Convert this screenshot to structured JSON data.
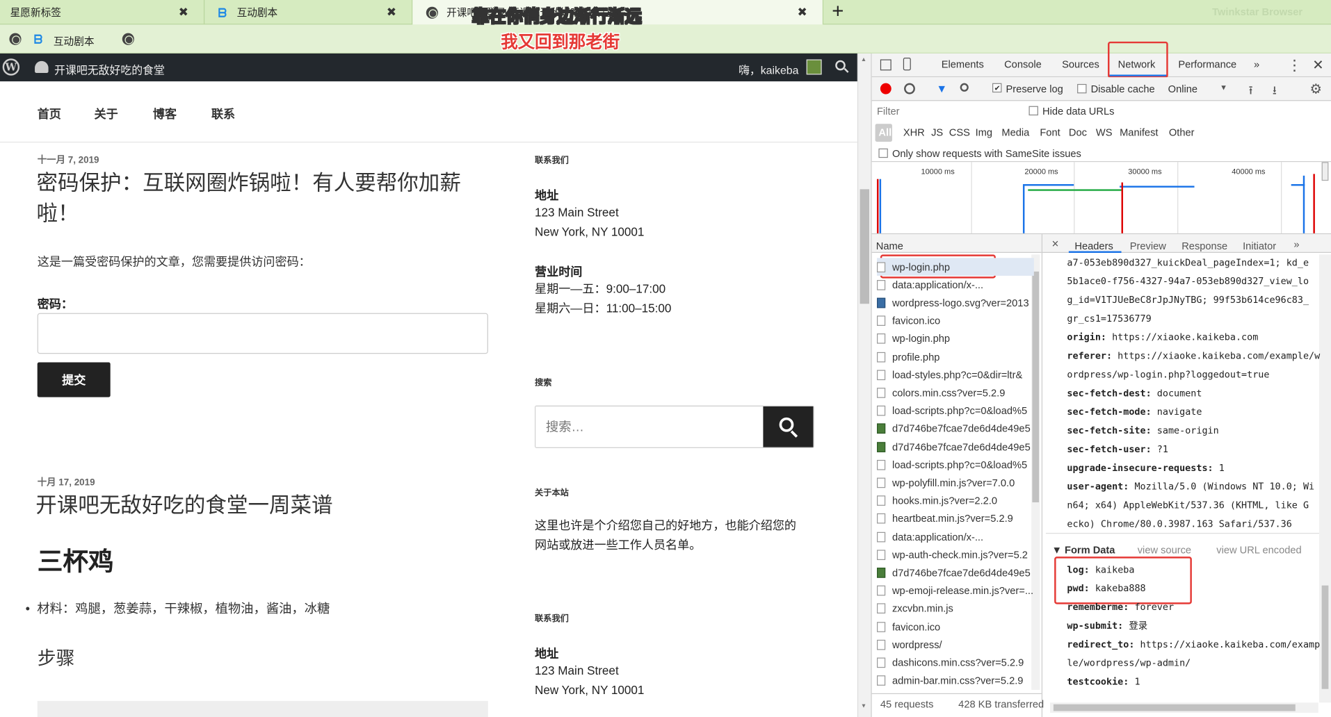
{
  "browser": {
    "tabs": [
      {
        "label": "星愿新标签",
        "close": "✖"
      },
      {
        "label": "互动剧本",
        "close": "✖"
      },
      {
        "label": "开课吧...登录‹开课吧无敌好吃的食堂",
        "close": "✖"
      }
    ],
    "new_tab": "+",
    "brand": "Twinkstar Browser",
    "bookmark": "互动剧本",
    "overlay_line1": "靠在你俏身边渐行渐远",
    "overlay_line2": "我又回到那老街"
  },
  "adminbar": {
    "site_name": "开课吧无敌好吃的食堂",
    "greeting": "嗨，kaikeba"
  },
  "page": {
    "nav": [
      "首页",
      "关于",
      "博客",
      "联系"
    ],
    "post1": {
      "date": "十一月 7, 2019",
      "title_line1": "密码保护：互联网圈炸锅啦！有人要帮你加薪",
      "title_line2": "啦！",
      "desc": "这是一篇受密码保护的文章，您需要提供访问密码：",
      "password_label": "密码：",
      "submit": "提交"
    },
    "post2": {
      "date": "十月 17, 2019",
      "title": "开课吧无敌好吃的食堂一周菜谱",
      "heading": "三杯鸡",
      "ingredients": "材料：鸡腿，葱姜蒜，干辣椒，植物油，酱油，冰糖",
      "steps": "步骤"
    },
    "sidebar": {
      "contact_heading": "联系我们",
      "address_label": "地址",
      "address_line1": "123 Main Street",
      "address_line2": "New York, NY 10001",
      "hours_label": "营业时间",
      "hours_line1": "星期一—五：9:00–17:00",
      "hours_line2": "星期六—日：11:00–15:00",
      "search_heading": "搜索",
      "search_placeholder": "搜索…",
      "about_heading": "关于本站",
      "about_line1": "这里也许是个介绍您自己的好地方，也能介绍您的",
      "about_line2": "网站或放进一些工作人员名单。",
      "contact_heading2": "联系我们",
      "address_label2": "地址",
      "address2_line1": "123 Main Street",
      "address2_line2": "New York, NY 10001"
    }
  },
  "devtools": {
    "tabs": [
      "Elements",
      "Console",
      "Sources",
      "Network",
      "Performance",
      "»"
    ],
    "preserve_log": "Preserve log",
    "disable_cache": "Disable cache",
    "throttle": "Online",
    "filter_placeholder": "Filter",
    "hide_data_urls": "Hide data URLs",
    "type_filters": [
      "All",
      "XHR",
      "JS",
      "CSS",
      "Img",
      "Media",
      "Font",
      "Doc",
      "WS",
      "Manifest",
      "Other"
    ],
    "samesite": "Only show requests with SameSite issues",
    "timeline_ticks": [
      "10000 ms",
      "20000 ms",
      "30000 ms",
      "40000 ms"
    ],
    "name_header": "Name",
    "requests": [
      "wp-login.php",
      "data:application/x-...",
      "wordpress-logo.svg?ver=2013",
      "favicon.ico",
      "wp-login.php",
      "profile.php",
      "load-styles.php?c=0&dir=ltr&",
      "colors.min.css?ver=5.2.9",
      "load-scripts.php?c=0&load%5",
      "d7d746be7fcae7de6d4de49e5",
      "d7d746be7fcae7de6d4de49e5",
      "load-scripts.php?c=0&load%5",
      "wp-polyfill.min.js?ver=7.0.0",
      "hooks.min.js?ver=2.2.0",
      "heartbeat.min.js?ver=5.2.9",
      "data:application/x-...",
      "wp-auth-check.min.js?ver=5.2",
      "d7d746be7fcae7de6d4de49e5",
      "wp-emoji-release.min.js?ver=...",
      "zxcvbn.min.js",
      "favicon.ico",
      "wordpress/",
      "dashicons.min.css?ver=5.2.9",
      "admin-bar.min.css?ver=5.2.9"
    ],
    "request_icons": [
      "doc",
      "doc",
      "svg",
      "doc",
      "doc",
      "doc",
      "doc",
      "doc",
      "doc",
      "img",
      "img",
      "doc",
      "doc",
      "doc",
      "doc",
      "doc",
      "doc",
      "img",
      "doc",
      "doc",
      "doc",
      "doc",
      "doc",
      "doc"
    ],
    "status_requests": "45 requests",
    "status_transferred": "428 KB transferred",
    "detail_tabs": [
      "Headers",
      "Preview",
      "Response",
      "Initiator",
      "»"
    ],
    "close": "×",
    "headers": [
      {
        "k": "",
        "v": "a7-053eb890d327_kuickDeal_pageIndex=1; kd_e"
      },
      {
        "k": "",
        "v": "5b1ace0-f756-4327-94a7-053eb890d327_view_lo"
      },
      {
        "k": "",
        "v": "g_id=V1TJUeBeC8rJpJNyTBG; 99f53b614ce96c83_"
      },
      {
        "k": "",
        "v": "gr_cs1=17536779"
      },
      {
        "k": "origin:",
        "v": " https://xiaoke.kaikeba.com"
      },
      {
        "k": "referer:",
        "v": " https://xiaoke.kaikeba.com/example/w"
      },
      {
        "k": "",
        "v": "ordpress/wp-login.php?loggedout=true"
      },
      {
        "k": "sec-fetch-dest:",
        "v": " document"
      },
      {
        "k": "sec-fetch-mode:",
        "v": " navigate"
      },
      {
        "k": "sec-fetch-site:",
        "v": " same-origin"
      },
      {
        "k": "sec-fetch-user:",
        "v": " ?1"
      },
      {
        "k": "upgrade-insecure-requests:",
        "v": " 1"
      },
      {
        "k": "user-agent:",
        "v": " Mozilla/5.0 (Windows NT 10.0; Wi"
      },
      {
        "k": "",
        "v": "n64; x64) AppleWebKit/537.36 (KHTML, like G"
      },
      {
        "k": "",
        "v": "ecko) Chrome/80.0.3987.163 Safari/537.36"
      }
    ],
    "form_data_title": "▼ Form Data",
    "view_source": "view source",
    "view_url_encoded": "view URL encoded",
    "form": [
      {
        "k": "log:",
        "v": " kaikeba"
      },
      {
        "k": "pwd:",
        "v": " kakeba888"
      },
      {
        "k": "rememberme:",
        "v": " forever"
      },
      {
        "k": "wp-submit:",
        "v": " 登录"
      },
      {
        "k": "redirect_to:",
        "v": " https://xiaoke.kaikeba.com/examp"
      },
      {
        "k": "",
        "v": "le/wordpress/wp-admin/"
      },
      {
        "k": "testcookie:",
        "v": " 1"
      }
    ]
  }
}
